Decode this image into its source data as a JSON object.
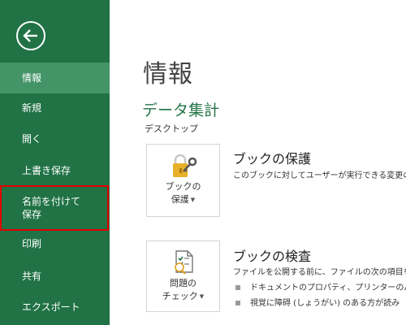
{
  "sidebar": {
    "back_icon": "back-arrow-icon",
    "items": [
      {
        "label": "情報"
      },
      {
        "label": "新規"
      },
      {
        "label": "開く"
      },
      {
        "label": "上書き保存"
      },
      {
        "label_line1": "名前を付けて",
        "label_line2": "保存"
      },
      {
        "label": "印刷"
      },
      {
        "label": "共有"
      },
      {
        "label": "エクスポート"
      }
    ],
    "background": "#217346",
    "active_background": "#439467",
    "highlight_border": "#e30000"
  },
  "main": {
    "title": "情報",
    "file_name": "データ集計",
    "file_path": "デスクトップ",
    "protect": {
      "button_line1": "ブックの",
      "button_line2": "保護",
      "icon": "padlock-key-icon",
      "title": "ブックの保護",
      "description": "このブックに対してユーザーが実行できる変更の"
    },
    "inspect": {
      "button_line1": "問題の",
      "button_line2": "チェック",
      "icon": "checklist-inspect-icon",
      "title": "ブックの検査",
      "description": "ファイルを公開する前に、ファイルの次の項目を",
      "bullets": [
        "ドキュメントのプロパティ、プリンターのパス",
        "視覚に障碍 (しょうがい) のある方が読み"
      ]
    },
    "accent_color": "#217346"
  }
}
